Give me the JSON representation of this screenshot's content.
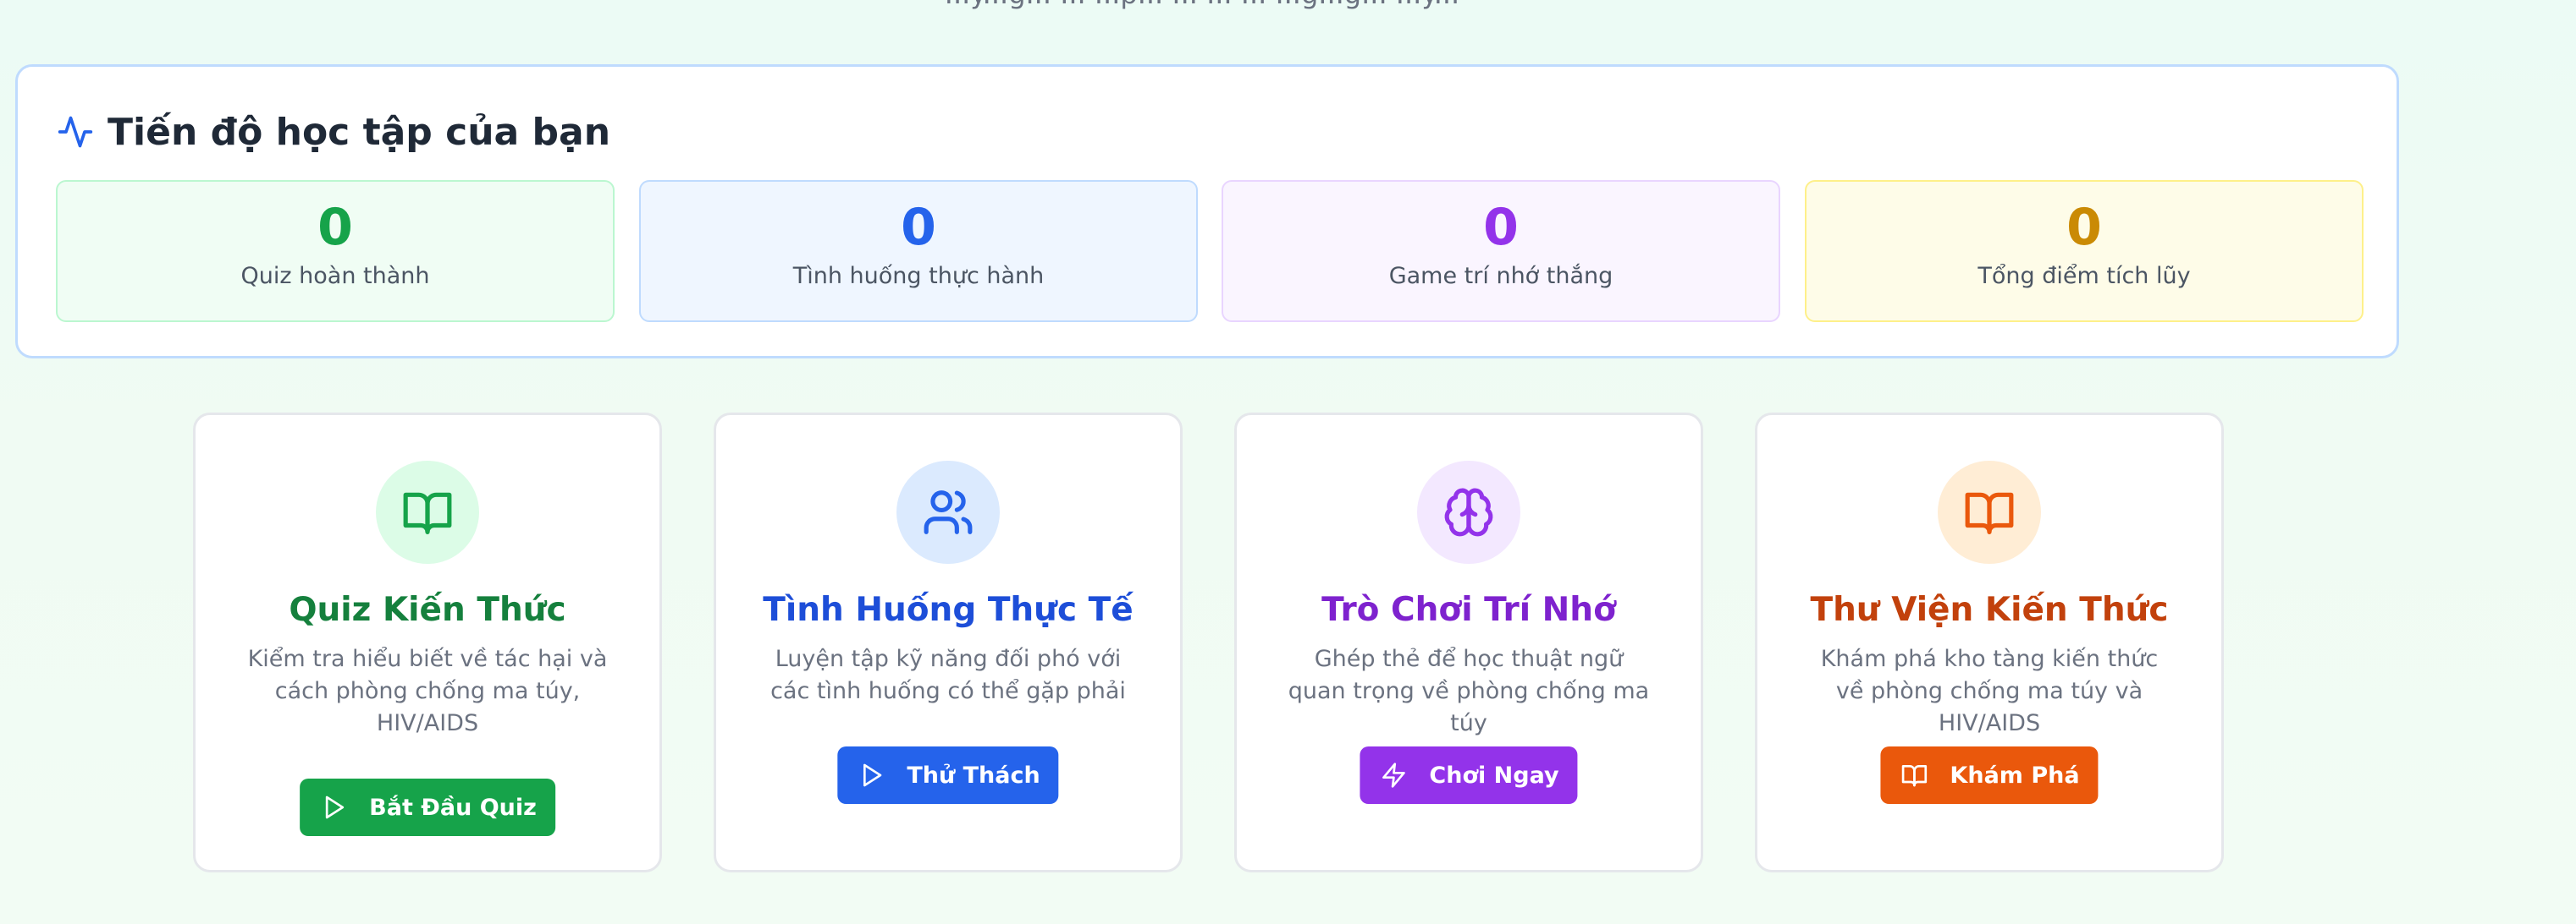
{
  "top_text": "...y...g... ... ...p... ... ... ... ...g...g... ...y...",
  "progress": {
    "title": "Tiến độ học tập của bạn",
    "icon": "activity-icon",
    "stats": [
      {
        "value": "0",
        "label": "Quiz hoàn thành",
        "color": "#16a34a",
        "bg": "#f0fdf4",
        "border": "#bbf7d0"
      },
      {
        "value": "0",
        "label": "Tình huống thực hành",
        "color": "#2563eb",
        "bg": "#eff6ff",
        "border": "#bfdbfe"
      },
      {
        "value": "0",
        "label": "Game trí nhớ thắng",
        "color": "#9333ea",
        "bg": "#faf5ff",
        "border": "#e9d5ff"
      },
      {
        "value": "0",
        "label": "Tổng điểm tích lũy",
        "color": "#ca8a04",
        "bg": "#fefce8",
        "border": "#fef08a"
      }
    ]
  },
  "cards": [
    {
      "title": "Quiz Kiến Thức",
      "desc": "Kiểm tra hiểu biết về tác hại và cách phòng chống ma túy, HIV/AIDS",
      "button": "Bắt Đầu Quiz",
      "icon": "book-open-icon",
      "button_icon": "play-icon",
      "title_color": "#15803d",
      "icon_color": "#16a34a",
      "icon_bg": "#dcfce7",
      "button_bg": "#16a34a"
    },
    {
      "title": "Tình Huống Thực Tế",
      "desc": "Luyện tập kỹ năng đối phó với các tình huống có thể gặp phải",
      "button": "Thử Thách",
      "icon": "users-icon",
      "button_icon": "play-icon",
      "title_color": "#1d4ed8",
      "icon_color": "#2563eb",
      "icon_bg": "#dbeafe",
      "button_bg": "#2563eb"
    },
    {
      "title": "Trò Chơi Trí Nhớ",
      "desc": "Ghép thẻ để học thuật ngữ quan trọng về phòng chống ma túy",
      "button": "Chơi Ngay",
      "icon": "brain-icon",
      "button_icon": "zap-icon",
      "title_color": "#7e22ce",
      "icon_color": "#9333ea",
      "icon_bg": "#f3e8ff",
      "button_bg": "#9333ea"
    },
    {
      "title": "Thư Viện Kiến Thức",
      "desc": "Khám phá kho tàng kiến thức về phòng chống ma túy và HIV/AIDS",
      "button": "Khám Phá",
      "icon": "book-open-icon",
      "button_icon": "book-open-icon",
      "title_color": "#c2410c",
      "icon_color": "#ea580c",
      "icon_bg": "#ffedd5",
      "button_bg": "#ea580c"
    }
  ]
}
